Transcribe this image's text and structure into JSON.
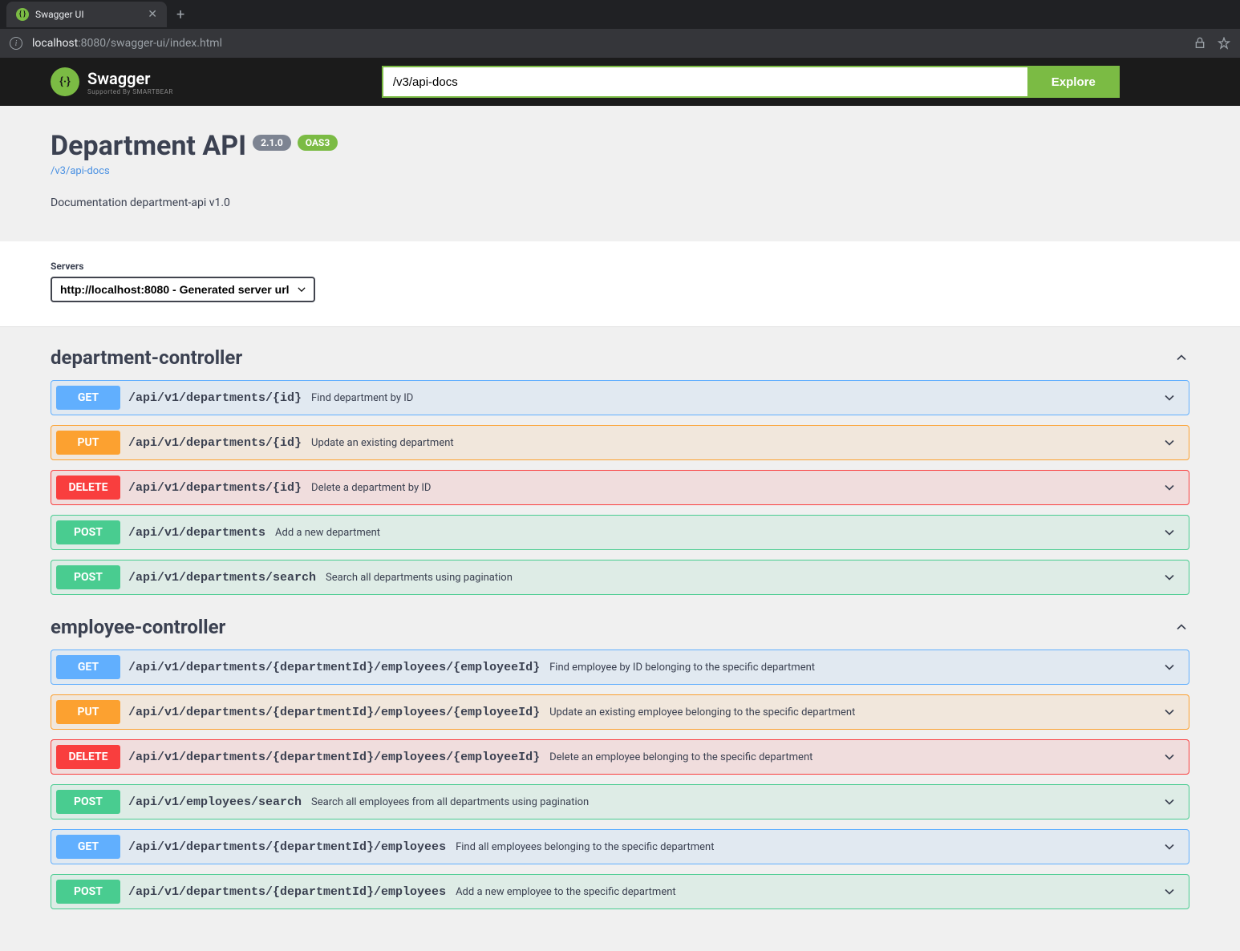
{
  "browser": {
    "tab_title": "Swagger UI",
    "url_host": "localhost",
    "url_path": ":8080/swagger-ui/index.html"
  },
  "header": {
    "logo": "Swagger",
    "logo_sub": "Supported By SMARTBEAR",
    "spec_url": "/v3/api-docs",
    "explore": "Explore"
  },
  "info": {
    "title": "Department API",
    "version": "2.1.0",
    "oas": "OAS3",
    "link": "/v3/api-docs",
    "description": "Documentation department-api v1.0"
  },
  "servers": {
    "label": "Servers",
    "selected": "http://localhost:8080 - Generated server url"
  },
  "tags": [
    {
      "name": "department-controller",
      "operations": [
        {
          "method": "GET",
          "path": "/api/v1/departments/{id}",
          "desc": "Find department by ID"
        },
        {
          "method": "PUT",
          "path": "/api/v1/departments/{id}",
          "desc": "Update an existing department"
        },
        {
          "method": "DELETE",
          "path": "/api/v1/departments/{id}",
          "desc": "Delete a department by ID"
        },
        {
          "method": "POST",
          "path": "/api/v1/departments",
          "desc": "Add a new department"
        },
        {
          "method": "POST",
          "path": "/api/v1/departments/search",
          "desc": "Search all departments using pagination"
        }
      ]
    },
    {
      "name": "employee-controller",
      "operations": [
        {
          "method": "GET",
          "path": "/api/v1/departments/{departmentId}/employees/{employeeId}",
          "desc": "Find employee by ID belonging to the specific department"
        },
        {
          "method": "PUT",
          "path": "/api/v1/departments/{departmentId}/employees/{employeeId}",
          "desc": "Update an existing employee belonging to the specific department"
        },
        {
          "method": "DELETE",
          "path": "/api/v1/departments/{departmentId}/employees/{employeeId}",
          "desc": "Delete an employee belonging to the specific department"
        },
        {
          "method": "POST",
          "path": "/api/v1/employees/search",
          "desc": "Search all employees from all departments using pagination"
        },
        {
          "method": "GET",
          "path": "/api/v1/departments/{departmentId}/employees",
          "desc": "Find all employees belonging to the specific department"
        },
        {
          "method": "POST",
          "path": "/api/v1/departments/{departmentId}/employees",
          "desc": "Add a new employee to the specific department"
        }
      ]
    }
  ]
}
